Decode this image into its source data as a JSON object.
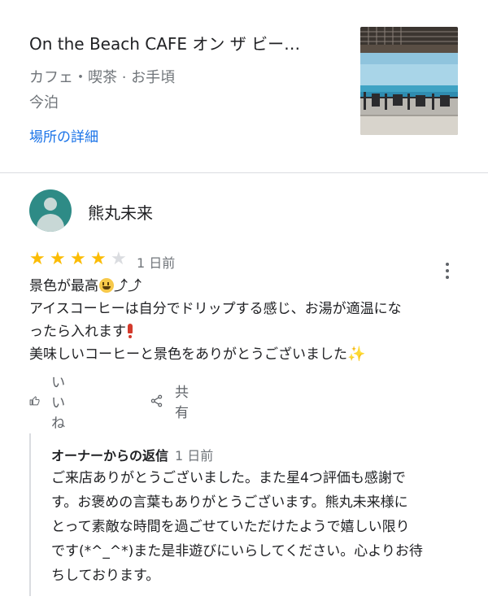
{
  "place": {
    "name": "On the Beach CAFE オン ザ ビー…",
    "category": "カフェ・喫茶 · お手頃",
    "area": "今泊",
    "details_link": "場所の詳細",
    "photo_icon": "place-photo"
  },
  "review": {
    "author": "熊丸未来",
    "rating": 4,
    "rating_max": 5,
    "stars": [
      "★",
      "★",
      "★",
      "★",
      "★"
    ],
    "date": "1 日前",
    "text_lines": [
      "景色が最高",
      "アイスコーヒーは自分でドリップする感じ、お湯が適温にな",
      "ったら入れます",
      "美味しいコーヒーと景色をありがとうございました"
    ],
    "emoji": {
      "arrows": "⤴⤴",
      "sparkle": "✨"
    },
    "actions": {
      "like": "いいね",
      "share": "共有"
    }
  },
  "owner_reply": {
    "title": "オーナーからの返信",
    "date": "1 日前",
    "text_lines": [
      "ご来店ありがとうございました。また星4つ評価も感謝で",
      "す。お褒めの言葉もありがとうございます。熊丸未来様に",
      "とって素敵な時間を過ごせていただけたようで嬉しい限り",
      "です(*^_^*)また是非遊びにいらしてください。心よりお待",
      "ちしております。"
    ]
  },
  "colors": {
    "star_filled": "#fbbc04",
    "star_empty": "#dadce0",
    "link": "#1a73e8",
    "secondary_text": "#70757a",
    "avatar_bg": "#2e8b86"
  }
}
